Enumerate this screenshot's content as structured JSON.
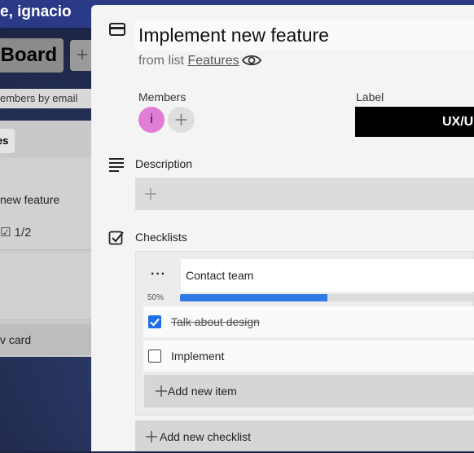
{
  "board": {
    "greeting": "e, ignacio",
    "board_button": "Board",
    "add_board": "+",
    "members_email_placeholder": "embers by email",
    "list_title": "es",
    "card_title": "new feature",
    "card_checklist": "1/2",
    "add_card": "v card"
  },
  "modal": {
    "icon": "card-icon",
    "title": "Implement new feature",
    "from_list_prefix": "from list",
    "from_list_link": "Features",
    "watch_icon": "eye-icon",
    "members": {
      "label": "Members",
      "avatars": [
        "i"
      ]
    },
    "label": {
      "heading": "Label",
      "value": "UX/U"
    },
    "description": {
      "heading": "Description"
    },
    "checklists": {
      "heading": "Checklists",
      "lists": [
        {
          "title": "Contact team",
          "progress_label": "50%",
          "progress": 0.5,
          "items": [
            {
              "text": "Talk about design",
              "checked": true
            },
            {
              "text": "Implement",
              "checked": false
            }
          ],
          "add_item": "Add new item"
        }
      ],
      "add_checklist": "Add new checklist"
    }
  },
  "colors": {
    "accent": "#2f7ae5",
    "avatar": "#e07dd5",
    "label": "#000000",
    "topbar": "#2b3a86"
  }
}
